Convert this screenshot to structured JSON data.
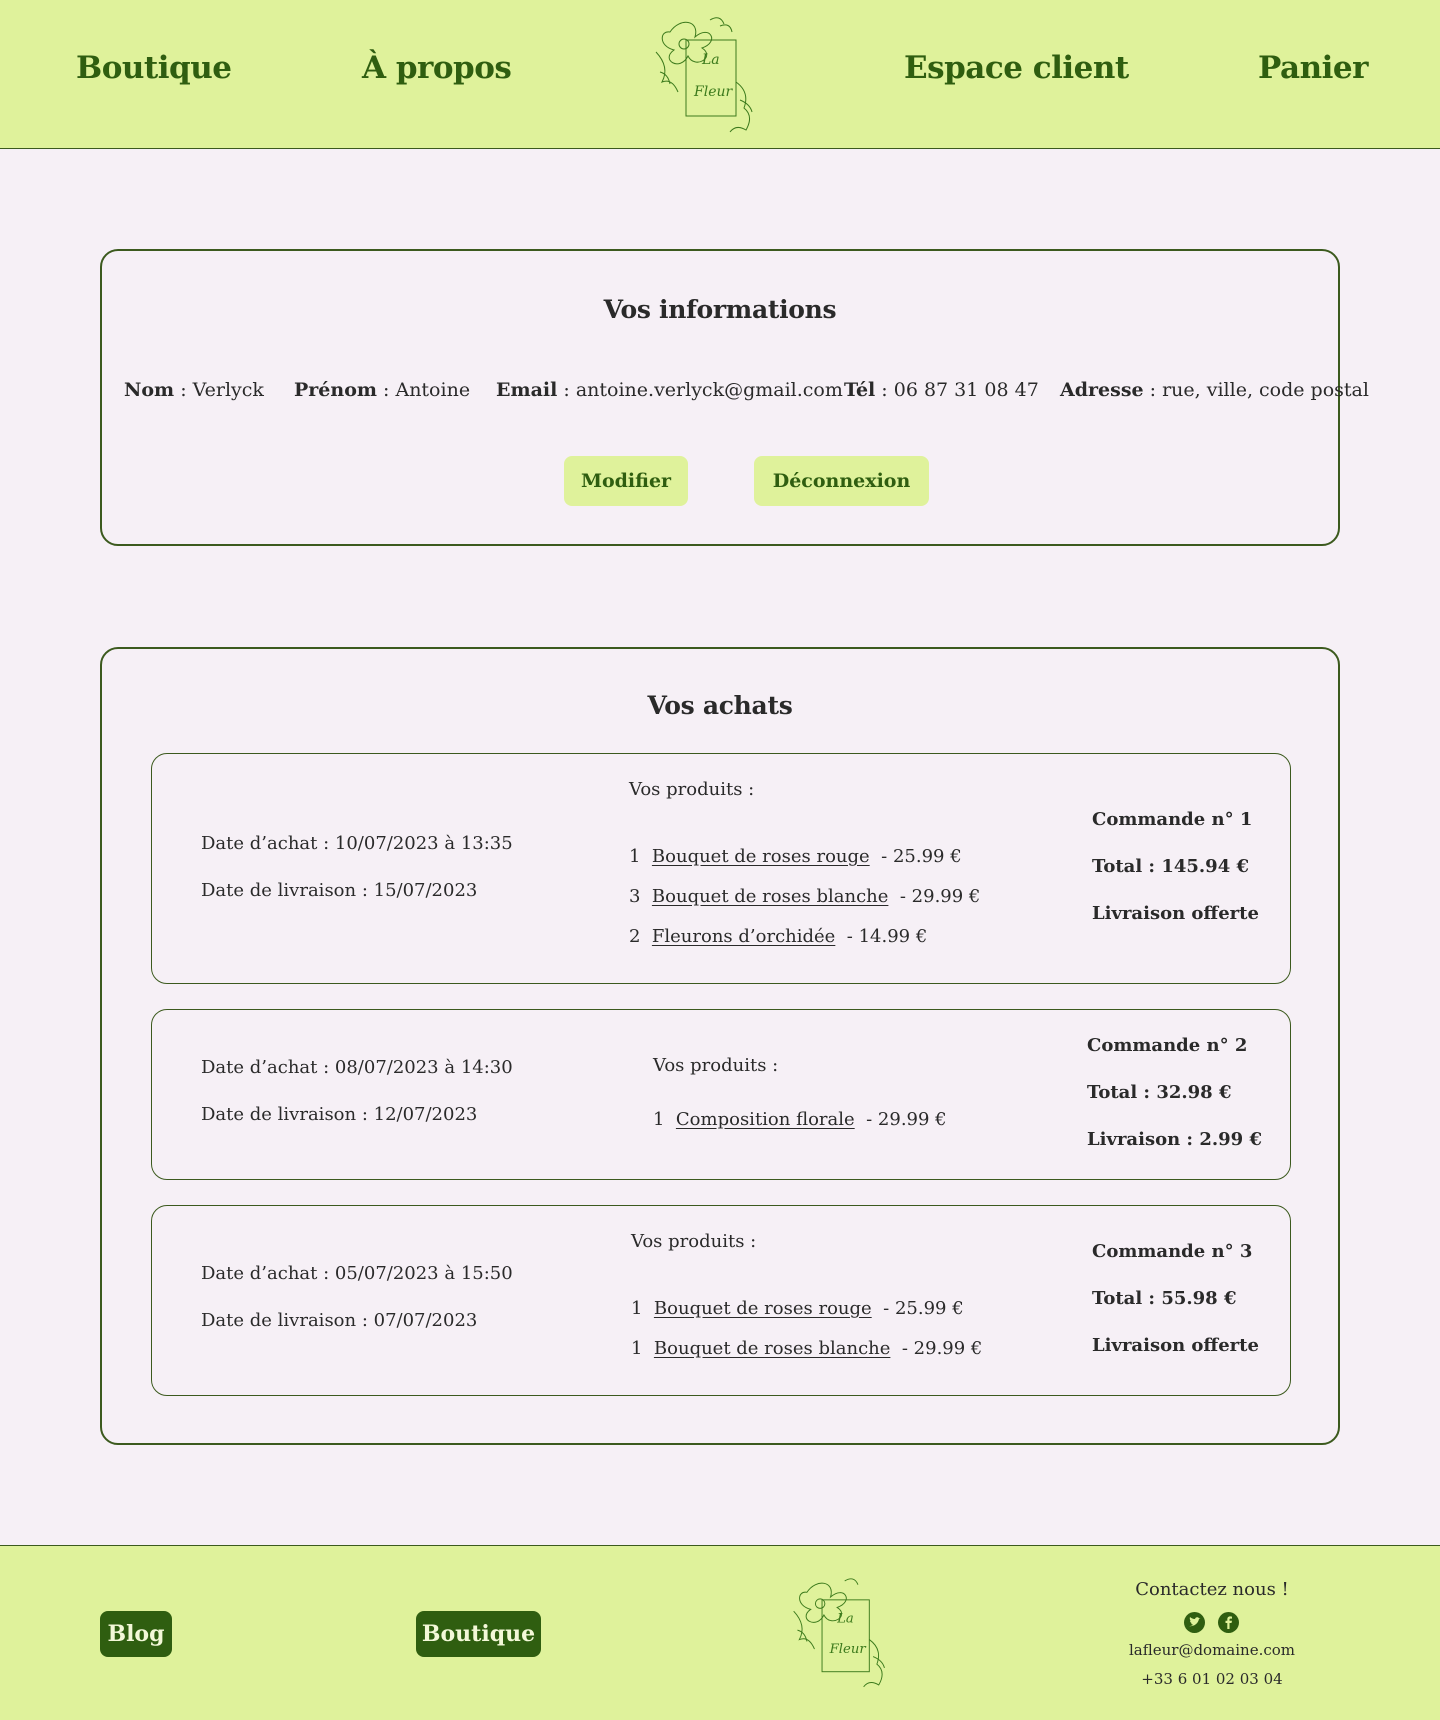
{
  "nav": {
    "boutique": "Boutique",
    "apropos": "À propos",
    "espace_client": "Espace client",
    "panier": "Panier"
  },
  "logo": {
    "line1": "La",
    "line2": "Fleur"
  },
  "info": {
    "title": "Vos informations",
    "nom_label": "Nom",
    "nom_value": "Verlyck",
    "prenom_label": "Prénom",
    "prenom_value": "Antoine",
    "email_label": "Email",
    "email_value": "antoine.verlyck@gmail.com",
    "tel_label": "Tél",
    "tel_value": "06 87 31 08 47",
    "adresse_label": "Adresse",
    "adresse_value": "rue, ville, code postal",
    "modify_btn": "Modifier",
    "logout_btn": "Déconnexion"
  },
  "achats": {
    "title": "Vos achats",
    "orders": [
      {
        "purchase_date": "Date d’achat : 10/07/2023 à 13:35",
        "delivery_date": "Date de livraison : 15/07/2023",
        "products_label": "Vos produits :",
        "products": [
          {
            "qty": "1",
            "name": "Bouquet de roses rouge",
            "price": "- 25.99 €"
          },
          {
            "qty": "3",
            "name": "Bouquet de roses blanche",
            "price": "- 29.99 €"
          },
          {
            "qty": "2",
            "name": "Fleurons d’orchidée",
            "price": "- 14.99 €"
          }
        ],
        "order_number": "Commande n° 1",
        "total": "Total : 145.94 €",
        "shipping": "Livraison offerte"
      },
      {
        "purchase_date": "Date d’achat : 08/07/2023 à 14:30",
        "delivery_date": "Date de livraison : 12/07/2023",
        "products_label": "Vos produits :",
        "products": [
          {
            "qty": "1",
            "name": "Composition florale",
            "price": "- 29.99 €"
          }
        ],
        "order_number": "Commande n° 2",
        "total": "Total : 32.98 €",
        "shipping": "Livraison : 2.99 €"
      },
      {
        "purchase_date": "Date d’achat : 05/07/2023 à 15:50",
        "delivery_date": "Date de livraison : 07/07/2023",
        "products_label": "Vos produits :",
        "products": [
          {
            "qty": "1",
            "name": "Bouquet de roses rouge",
            "price": "- 25.99 €"
          },
          {
            "qty": "1",
            "name": "Bouquet de roses blanche",
            "price": "- 29.99 €"
          }
        ],
        "order_number": "Commande n° 3",
        "total": "Total : 55.98 €",
        "shipping": "Livraison offerte"
      }
    ]
  },
  "footer": {
    "blog_btn": "Blog",
    "boutique_btn": "Boutique",
    "contact_title": "Contactez nous !",
    "email": "lafleur@domaine.com",
    "phone": "+33 6 01 02 03 04",
    "icons": [
      "twitter-icon",
      "facebook-icon"
    ]
  },
  "colors": {
    "header_bg": "#dff29b",
    "accent_green": "#2f5e10",
    "page_bg": "#f6f0f6",
    "border": "#3c5a1e"
  }
}
